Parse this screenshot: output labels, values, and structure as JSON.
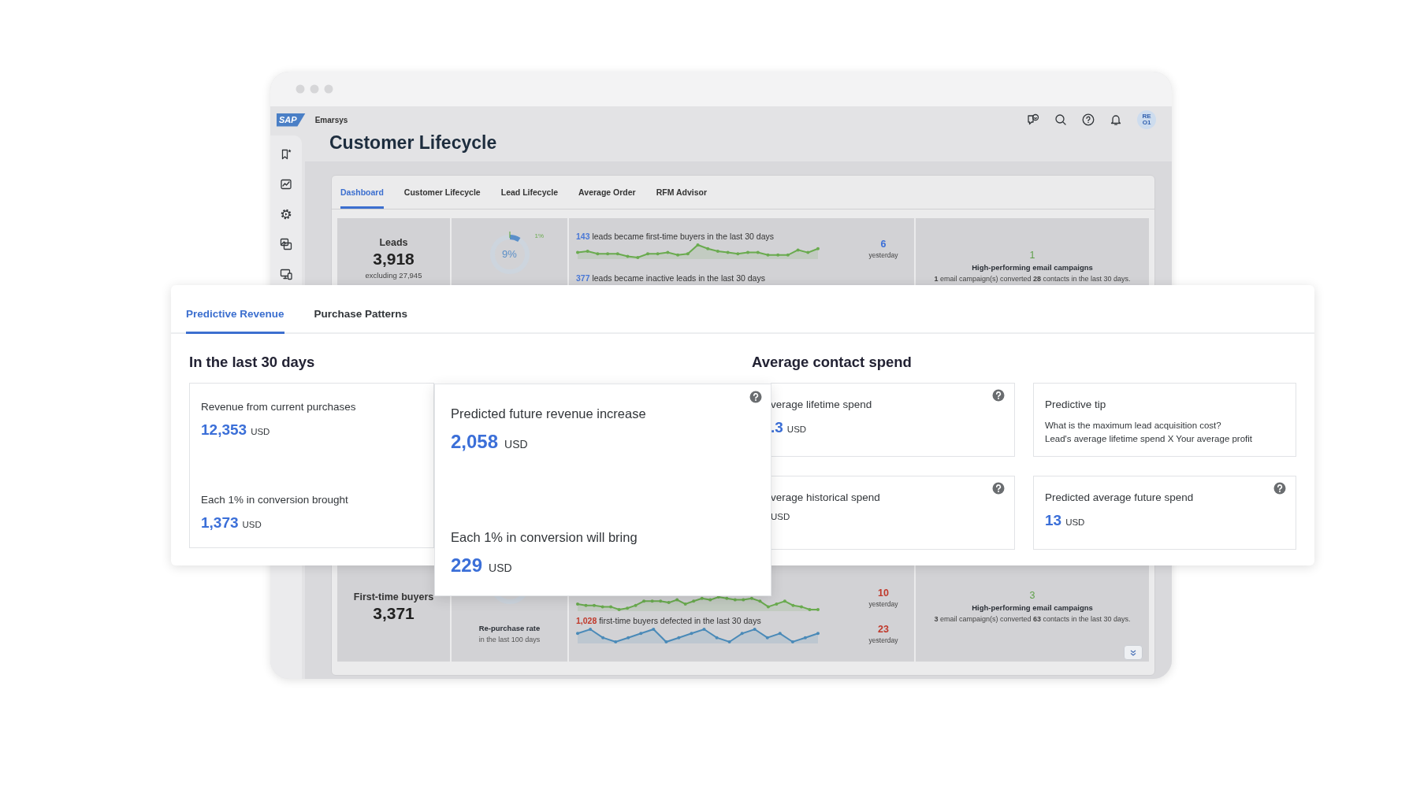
{
  "window": {
    "logo": "SAP",
    "brand": "Emarsys",
    "avatar": "RE O1",
    "title": "Customer Lifecycle",
    "tabs": [
      {
        "label": "Dashboard",
        "selected": true
      },
      {
        "label": "Customer Lifecycle",
        "selected": false
      },
      {
        "label": "Lead Lifecycle",
        "selected": false
      },
      {
        "label": "Average Order",
        "selected": false
      },
      {
        "label": "RFM Advisor",
        "selected": false
      }
    ],
    "rows": [
      {
        "label": "Leads",
        "value": "3,918",
        "note": "excluding 27,945",
        "donut": {
          "reading": "9%",
          "level": 0.09,
          "marker": "1%"
        },
        "trends": [
          {
            "count": "143",
            "text": "leads became first-time buyers in the last 30 days",
            "color": "#4a78d6",
            "sparkline": {
              "color": "#6aab4f"
            },
            "delta": {
              "value": "6",
              "color": "#3b6fd8",
              "note": "yesterday"
            }
          },
          {
            "count": "377",
            "text": "leads became inactive leads in the last 30 days",
            "color": "#4a78d6"
          }
        ],
        "campaigns": {
          "count": "1",
          "title": "High-performing email campaigns",
          "summary": "**1** email campaign(s) converted **28** contacts in the last 30 days."
        }
      },
      {
        "label": "First-time buyers",
        "value": "3,371",
        "donut": {
          "caption": "Re-purchase rate",
          "note": "in the last 100 days"
        },
        "trends": [
          {
            "sparkline": {
              "color": "#6aab4f"
            },
            "delta": {
              "value": "10",
              "color": "#c0392b",
              "note": "yesterday"
            }
          },
          {
            "count": "1,028",
            "text": "first-time buyers defected in the last 30 days",
            "color": "#c0392b",
            "sparkline": {
              "color": "#4a8ab8"
            },
            "delta": {
              "value": "23",
              "color": "#c0392b",
              "note": "yesterday"
            }
          }
        ],
        "campaigns": {
          "count": "3",
          "title": "High-performing email campaigns",
          "summary": "**3** email campaign(s) converted **63** contacts in the last 30 days."
        },
        "expandable": true
      }
    ]
  },
  "overlay": {
    "tabs": [
      {
        "label": "Predictive Revenue",
        "selected": true
      },
      {
        "label": "Purchase Patterns",
        "selected": false
      }
    ],
    "sections": [
      {
        "title": "In the last 30 days",
        "cards": [
          {
            "kind": "metrics",
            "metrics": [
              {
                "label": "Revenue from current purchases",
                "value": "12,353",
                "unit": "USD"
              },
              {
                "label": "Each 1% in conversion brought",
                "value": "1,373",
                "unit": "USD"
              }
            ]
          }
        ]
      },
      {
        "title": "Average contact spend",
        "cards": [
          {
            "kind": "metric",
            "label": "verage lifetime spend",
            "value": ".3",
            "unit": "USD",
            "help": true
          },
          {
            "kind": "tip",
            "title": "Predictive tip",
            "lines": [
              "What is the maximum lead acquisition cost?",
              "Lead's average lifetime spend X Your average profit"
            ]
          },
          {
            "kind": "metric",
            "label": "verage historical spend",
            "unit": "USD",
            "help": true
          },
          {
            "kind": "metric",
            "label": "Predicted average future spend",
            "value": "13",
            "unit": "USD",
            "help": true
          }
        ]
      }
    ]
  },
  "highlight_card": {
    "help": true,
    "metrics": [
      {
        "label": "Predicted future revenue increase",
        "value": "2,058",
        "unit": "USD"
      },
      {
        "label": "Each 1% in conversion will bring",
        "value": "229",
        "unit": "USD"
      }
    ]
  }
}
